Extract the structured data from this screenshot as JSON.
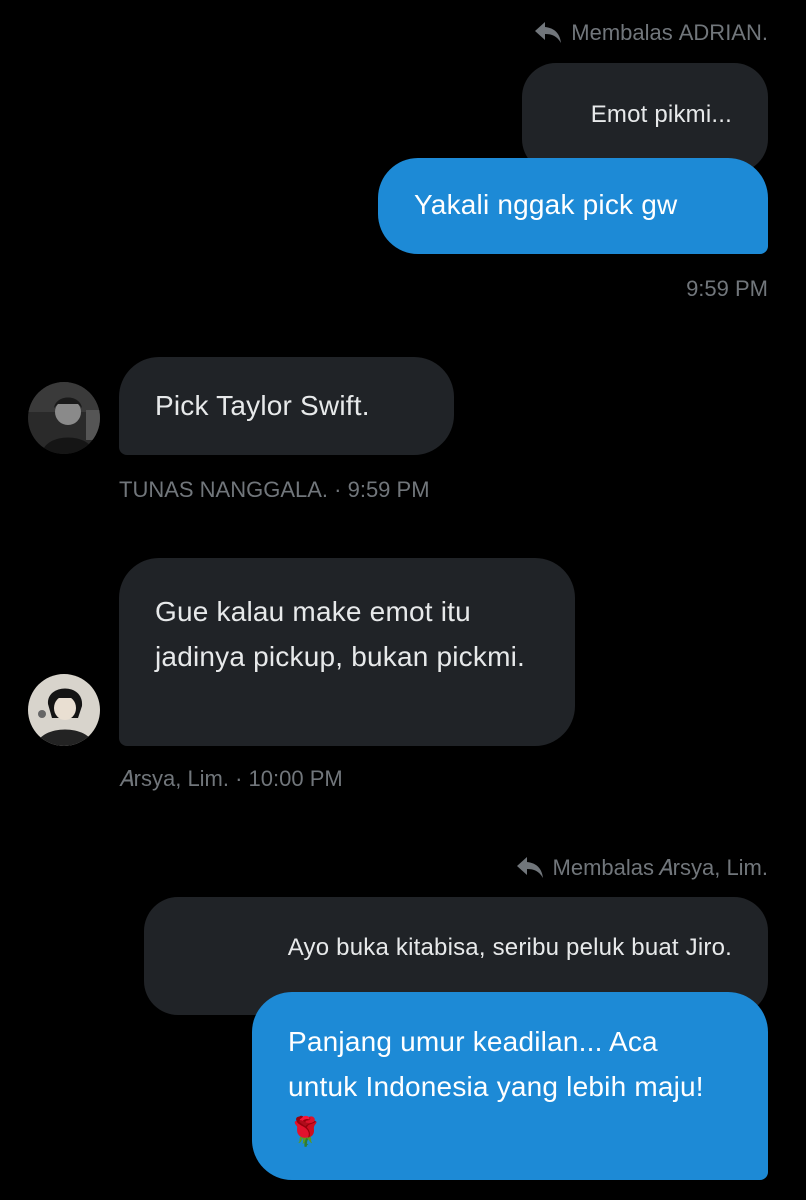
{
  "conversation": {
    "reply1": {
      "prefix": "Membalas",
      "name": "ADRIAN."
    },
    "quoted1": "Emot pikmi...",
    "sent1": "Yakali nggak pick gw",
    "sent1_time": "9:59 PM",
    "recv1": "Pick Taylor Swift.",
    "recv1_meta": "TUNAS NANGGALA. · 9:59 PM",
    "recv2": "Gue kalau make emot itu jadinya pickup, bukan pickmi.",
    "recv2_meta": "𝐴rsya, Lim. · 10:00 PM",
    "reply2": {
      "prefix": "Membalas",
      "name": "𝐴rsya, Lim."
    },
    "quoted2": "Ayo buka kitabisa, seribu peluk buat Jiro.",
    "sent2": "Panjang umur keadilan... Aca untuk Indonesia yang lebih maju! 🌹"
  },
  "colors": {
    "background": "#000000",
    "sent_bubble": "#1d8ad6",
    "received_bubble": "#202327",
    "muted_text": "#71767b"
  },
  "icons": {
    "reply": "reply-arrow-icon",
    "rose": "rose-emoji"
  }
}
